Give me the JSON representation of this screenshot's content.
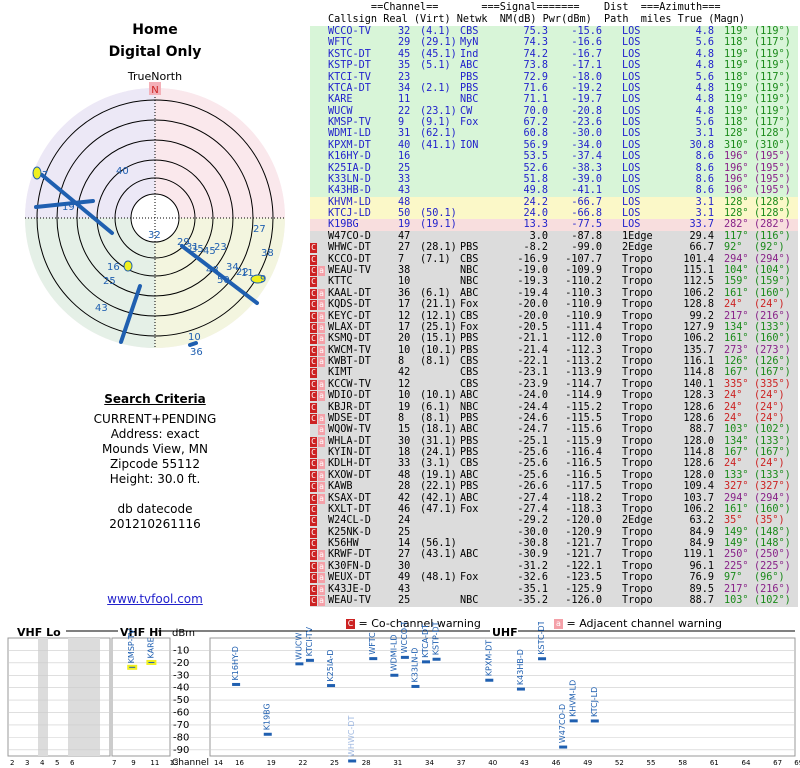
{
  "title": "Home",
  "subtitle": "Digital Only",
  "north_label": "TrueNorth",
  "north_letter": "N",
  "criteria": {
    "heading": "Search Criteria",
    "lines": [
      "CURRENT+PENDING",
      "Address: exact",
      "Mounds View, MN",
      "Zipcode 55112",
      "Height: 30.0 ft."
    ],
    "db_label": "db datecode",
    "db_value": "201210261116"
  },
  "link": "www.tvfool.com",
  "headers": {
    "line1": "       ==Channel==       ===Signal=======    Dist  ===Azimuth===",
    "line2": "Callsign Real (Virt) Netwk  NM(dB) Pwr(dBm)  Path  miles True (Magn)"
  },
  "stations": [
    [
      "WCCO-TV",
      "32",
      "(4.1)",
      "CBS",
      "75.3",
      "-15.6",
      "LOS",
      "4.8",
      "119°",
      "(119°)",
      "",
      ""
    ],
    [
      "WFTC",
      "29",
      "(29.1)",
      "MyN",
      "74.3",
      "-16.6",
      "LOS",
      "5.6",
      "118°",
      "(117°)",
      "",
      ""
    ],
    [
      "KSTC-DT",
      "45",
      "(45.1)",
      "Ind",
      "74.2",
      "-16.7",
      "LOS",
      "4.8",
      "119°",
      "(119°)",
      "",
      ""
    ],
    [
      "KSTP-DT",
      "35",
      "(5.1)",
      "ABC",
      "73.8",
      "-17.1",
      "LOS",
      "4.8",
      "119°",
      "(119°)",
      "",
      ""
    ],
    [
      "KTCI-TV",
      "23",
      "",
      "PBS",
      "72.9",
      "-18.0",
      "LOS",
      "5.6",
      "118°",
      "(117°)",
      "",
      ""
    ],
    [
      "KTCA-DT",
      "34",
      "(2.1)",
      "PBS",
      "71.6",
      "-19.2",
      "LOS",
      "4.8",
      "119°",
      "(119°)",
      "",
      ""
    ],
    [
      "KARE",
      "11",
      "",
      "NBC",
      "71.1",
      "-19.7",
      "LOS",
      "4.8",
      "119°",
      "(119°)",
      "",
      ""
    ],
    [
      "WUCW",
      "22",
      "(23.1)",
      "CW",
      "70.0",
      "-20.8",
      "LOS",
      "4.8",
      "119°",
      "(119°)",
      "",
      ""
    ],
    [
      "KMSP-TV",
      "9",
      "(9.1)",
      "Fox",
      "67.2",
      "-23.6",
      "LOS",
      "5.6",
      "118°",
      "(117°)",
      "",
      ""
    ],
    [
      "WDMI-LD",
      "31",
      "(62.1)",
      "",
      "60.8",
      "-30.0",
      "LOS",
      "3.1",
      "128°",
      "(128°)",
      "",
      ""
    ],
    [
      "KPXM-DT",
      "40",
      "(41.1)",
      "ION",
      "56.9",
      "-34.0",
      "LOS",
      "30.8",
      "310°",
      "(310°)",
      "",
      ""
    ],
    [
      "K16HY-D",
      "16",
      "",
      "",
      "53.5",
      "-37.4",
      "LOS",
      "8.6",
      "196°",
      "(195°)",
      "",
      ""
    ],
    [
      "K25IA-D",
      "25",
      "",
      "",
      "52.6",
      "-38.3",
      "LOS",
      "8.6",
      "196°",
      "(195°)",
      "",
      ""
    ],
    [
      "K33LN-D",
      "33",
      "",
      "",
      "51.8",
      "-39.0",
      "LOS",
      "8.6",
      "196°",
      "(195°)",
      "",
      ""
    ],
    [
      "K43HB-D",
      "43",
      "",
      "",
      "49.8",
      "-41.1",
      "LOS",
      "8.6",
      "196°",
      "(195°)",
      "",
      ""
    ],
    [
      "KHVM-LD",
      "48",
      "",
      "",
      "24.2",
      "-66.7",
      "LOS",
      "3.1",
      "128°",
      "(128°)",
      "",
      ""
    ],
    [
      "KTCJ-LD",
      "50",
      "(50.1)",
      "",
      "24.0",
      "-66.8",
      "LOS",
      "3.1",
      "128°",
      "(128°)",
      "",
      ""
    ],
    [
      "K19BG",
      "19",
      "(19.1)",
      "",
      "13.3",
      "-77.5",
      "LOS",
      "33.7",
      "282°",
      "(282°)",
      "",
      ""
    ],
    [
      "W47CO-D",
      "47",
      "",
      "",
      "3.0",
      "-87.8",
      "1Edge",
      "29.4",
      "117°",
      "(116°)",
      "",
      ""
    ],
    [
      "WHWC-DT",
      "27",
      "(28.1)",
      "PBS",
      "-8.2",
      "-99.0",
      "2Edge",
      "66.7",
      "92°",
      "(92°)",
      "C",
      ""
    ],
    [
      "KCCO-DT",
      "7",
      "(7.1)",
      "CBS",
      "-16.9",
      "-107.7",
      "Tropo",
      "101.4",
      "294°",
      "(294°)",
      "C",
      ""
    ],
    [
      "WEAU-TV",
      "38",
      "",
      "NBC",
      "-19.0",
      "-109.9",
      "Tropo",
      "115.1",
      "104°",
      "(104°)",
      "C",
      "a"
    ],
    [
      "KTTC",
      "10",
      "",
      "NBC",
      "-19.3",
      "-110.2",
      "Tropo",
      "112.5",
      "159°",
      "(159°)",
      "C",
      ""
    ],
    [
      "KAAL-DT",
      "36",
      "(6.1)",
      "ABC",
      "-19.4",
      "-110.3",
      "Tropo",
      "106.2",
      "161°",
      "(160°)",
      "C",
      "a"
    ],
    [
      "KQDS-DT",
      "17",
      "(21.1)",
      "Fox",
      "-20.0",
      "-110.9",
      "Tropo",
      "128.8",
      "24°",
      "(24°)",
      "C",
      "a"
    ],
    [
      "KEYC-DT",
      "12",
      "(12.1)",
      "CBS",
      "-20.0",
      "-110.9",
      "Tropo",
      "99.2",
      "217°",
      "(216°)",
      "C",
      "a"
    ],
    [
      "WLAX-DT",
      "17",
      "(25.1)",
      "Fox",
      "-20.5",
      "-111.4",
      "Tropo",
      "127.9",
      "134°",
      "(133°)",
      "C",
      "a"
    ],
    [
      "KSMQ-DT",
      "20",
      "(15.1)",
      "PBS",
      "-21.1",
      "-112.0",
      "Tropo",
      "106.2",
      "161°",
      "(160°)",
      "C",
      "a"
    ],
    [
      "KWCM-TV",
      "10",
      "(10.1)",
      "PBS",
      "-21.4",
      "-112.3",
      "Tropo",
      "135.7",
      "273°",
      "(273°)",
      "C",
      "a"
    ],
    [
      "KWBT-DT",
      "8",
      "(8.1)",
      "CBS",
      "-22.1",
      "-113.2",
      "Tropo",
      "116.1",
      "126°",
      "(126°)",
      "C",
      "a"
    ],
    [
      "KIMT",
      "42",
      "",
      "CBS",
      "-23.1",
      "-113.9",
      "Tropo",
      "114.8",
      "167°",
      "(167°)",
      "C",
      ""
    ],
    [
      "KCCW-TV",
      "12",
      "",
      "CBS",
      "-23.9",
      "-114.7",
      "Tropo",
      "140.1",
      "335°",
      "(335°)",
      "C",
      "a"
    ],
    [
      "WDIO-DT",
      "10",
      "(10.1)",
      "ABC",
      "-24.0",
      "-114.9",
      "Tropo",
      "128.3",
      "24°",
      "(24°)",
      "C",
      "a"
    ],
    [
      "KBJR-DT",
      "19",
      "(6.1)",
      "NBC",
      "-24.4",
      "-115.2",
      "Tropo",
      "128.6",
      "24°",
      "(24°)",
      "C",
      ""
    ],
    [
      "WDSE-DT",
      "8",
      "(8.1)",
      "PBS",
      "-24.6",
      "-115.5",
      "Tropo",
      "128.6",
      "24°",
      "(24°)",
      "C",
      "a"
    ],
    [
      "WQOW-TV",
      "15",
      "(18.1)",
      "ABC",
      "-24.7",
      "-115.6",
      "Tropo",
      "88.7",
      "103°",
      "(102°)",
      "",
      "a"
    ],
    [
      "WHLA-DT",
      "30",
      "(31.1)",
      "PBS",
      "-25.1",
      "-115.9",
      "Tropo",
      "128.0",
      "134°",
      "(133°)",
      "C",
      "a"
    ],
    [
      "KYIN-DT",
      "18",
      "(24.1)",
      "PBS",
      "-25.6",
      "-116.4",
      "Tropo",
      "114.8",
      "167°",
      "(167°)",
      "C",
      ""
    ],
    [
      "KDLH-DT",
      "33",
      "(3.1)",
      "CBS",
      "-25.6",
      "-116.5",
      "Tropo",
      "128.6",
      "24°",
      "(24°)",
      "C",
      "a"
    ],
    [
      "KXOW-DT",
      "48",
      "(19.1)",
      "ABC",
      "-25.6",
      "-116.5",
      "Tropo",
      "128.0",
      "133°",
      "(133°)",
      "C",
      "a"
    ],
    [
      "KAWB",
      "28",
      "(22.1)",
      "PBS",
      "-26.6",
      "-117.5",
      "Tropo",
      "109.4",
      "327°",
      "(327°)",
      "C",
      "a"
    ],
    [
      "KSAX-DT",
      "42",
      "(42.1)",
      "ABC",
      "-27.4",
      "-118.2",
      "Tropo",
      "103.7",
      "294°",
      "(294°)",
      "C",
      "a"
    ],
    [
      "KXLT-DT",
      "46",
      "(47.1)",
      "Fox",
      "-27.4",
      "-118.3",
      "Tropo",
      "106.2",
      "161°",
      "(160°)",
      "C",
      ""
    ],
    [
      "W24CL-D",
      "24",
      "",
      "",
      "-29.2",
      "-120.0",
      "2Edge",
      "63.2",
      "35°",
      "(35°)",
      "C",
      ""
    ],
    [
      "K25NK-D",
      "25",
      "",
      "",
      "-30.0",
      "-120.9",
      "Tropo",
      "84.9",
      "149°",
      "(148°)",
      "C",
      ""
    ],
    [
      "K56HW",
      "14",
      "(56.1)",
      "",
      "-30.8",
      "-121.7",
      "Tropo",
      "84.9",
      "149°",
      "(148°)",
      "C",
      ""
    ],
    [
      "KRWF-DT",
      "27",
      "(43.1)",
      "ABC",
      "-30.9",
      "-121.7",
      "Tropo",
      "119.1",
      "250°",
      "(250°)",
      "C",
      "a"
    ],
    [
      "K30FN-D",
      "30",
      "",
      "",
      "-31.2",
      "-122.1",
      "Tropo",
      "96.1",
      "225°",
      "(225°)",
      "C",
      "a"
    ],
    [
      "WEUX-DT",
      "49",
      "(48.1)",
      "Fox",
      "-32.6",
      "-123.5",
      "Tropo",
      "76.9",
      "97°",
      "(96°)",
      "C",
      "a"
    ],
    [
      "K43JE-D",
      "43",
      "",
      "",
      "-35.1",
      "-125.9",
      "Tropo",
      "89.5",
      "217°",
      "(216°)",
      "C",
      "a"
    ],
    [
      "WEAU-TV",
      "25",
      "",
      "NBC",
      "-35.2",
      "-126.0",
      "Tropo",
      "88.7",
      "103°",
      "(102°)",
      "C",
      "a"
    ]
  ],
  "legend": {
    "co_box": "C",
    "co_text": "= Co-channel warning",
    "adj_box": "a",
    "adj_text": "= Adjacent channel warning"
  },
  "spectrum": {
    "vhf_lo": "VHF Lo",
    "vhf_hi": "VHF Hi",
    "uhf": "UHF",
    "dbm": "dBm",
    "channel_label": "Channel",
    "y_ticks": [
      "-10",
      "-20",
      "-30",
      "-40",
      "-50",
      "-60",
      "-70",
      "-80",
      "-90"
    ],
    "lo_ticks": [
      "2",
      "3",
      "4",
      "5",
      "6"
    ],
    "hi_ticks": [
      "7",
      "9",
      "11",
      "13"
    ],
    "uhf_ticks": [
      "14",
      "16",
      "19",
      "22",
      "25",
      "28",
      "31",
      "34",
      "37",
      "40",
      "43",
      "46",
      "49",
      "52",
      "55",
      "58",
      "61",
      "64",
      "67",
      "69"
    ],
    "station_labels": [
      "KMSP-TV",
      "KARE",
      "K16HY-D",
      "K19BG",
      "KTCI-TV",
      "WUCW",
      "K25IA-D",
      "WHWC-DT",
      "WFTC",
      "WCCO-TV",
      "WDMI-LD",
      "K33LN-D",
      "KTCA-DT",
      "KSTP-DT",
      "KPXM-DT",
      "K43HB-D",
      "KSTC-DT",
      "W47CO-D",
      "KHVM-LD",
      "KTCJ-LD"
    ]
  },
  "colors": {
    "green": "#d8f5d8",
    "yellow": "#fbf8c8",
    "pink": "#f8dede",
    "gray": "#dcdcdc",
    "blue": "#2222cc",
    "warn": "#cc2222"
  },
  "radar_labels": [
    "7",
    "19",
    "40",
    "32",
    "29",
    "31",
    "35",
    "45",
    "23",
    "34",
    "22",
    "11",
    "9",
    "27",
    "38",
    "16",
    "25",
    "43",
    "48",
    "50",
    "10",
    "36"
  ]
}
